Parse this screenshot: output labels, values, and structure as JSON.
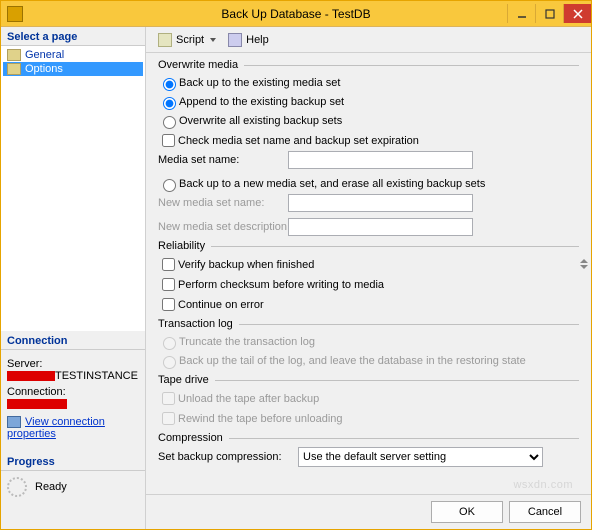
{
  "window": {
    "title": "Back Up Database - TestDB"
  },
  "leftpanel": {
    "select_page_hdr": "Select a page",
    "nav": {
      "general": "General",
      "options": "Options"
    },
    "connection_hdr": "Connection",
    "server_lbl": "Server:",
    "server_val_suffix": "TESTINSTANCE",
    "connection_lbl": "Connection:",
    "view_conn": "View connection properties",
    "progress_hdr": "Progress",
    "progress_val": "Ready"
  },
  "toolbar": {
    "script": "Script",
    "help": "Help"
  },
  "form": {
    "overwrite": {
      "title": "Overwrite media",
      "existing": "Back up to the existing media set",
      "append": "Append to the existing backup set",
      "overwrite_all": "Overwrite all existing backup sets",
      "check": "Check media set name and backup set expiration",
      "media_name_lbl": "Media set name:",
      "new_media": "Back up to a new media set, and erase all existing backup sets",
      "new_name_lbl": "New media set name:",
      "new_desc_lbl": "New media set description:"
    },
    "reliability": {
      "title": "Reliability",
      "verify": "Verify backup when finished",
      "checksum": "Perform checksum before writing to media",
      "continue": "Continue on error"
    },
    "tlog": {
      "title": "Transaction log",
      "truncate": "Truncate the transaction log",
      "tail": "Back up the tail of the log, and leave the database in the restoring state"
    },
    "tape": {
      "title": "Tape drive",
      "unload": "Unload the tape after backup",
      "rewind": "Rewind the tape before unloading"
    },
    "comp": {
      "title": "Compression",
      "lbl": "Set backup compression:",
      "value": "Use the default server setting"
    }
  },
  "footer": {
    "ok": "OK",
    "cancel": "Cancel"
  },
  "watermark": "wsxdn.com"
}
